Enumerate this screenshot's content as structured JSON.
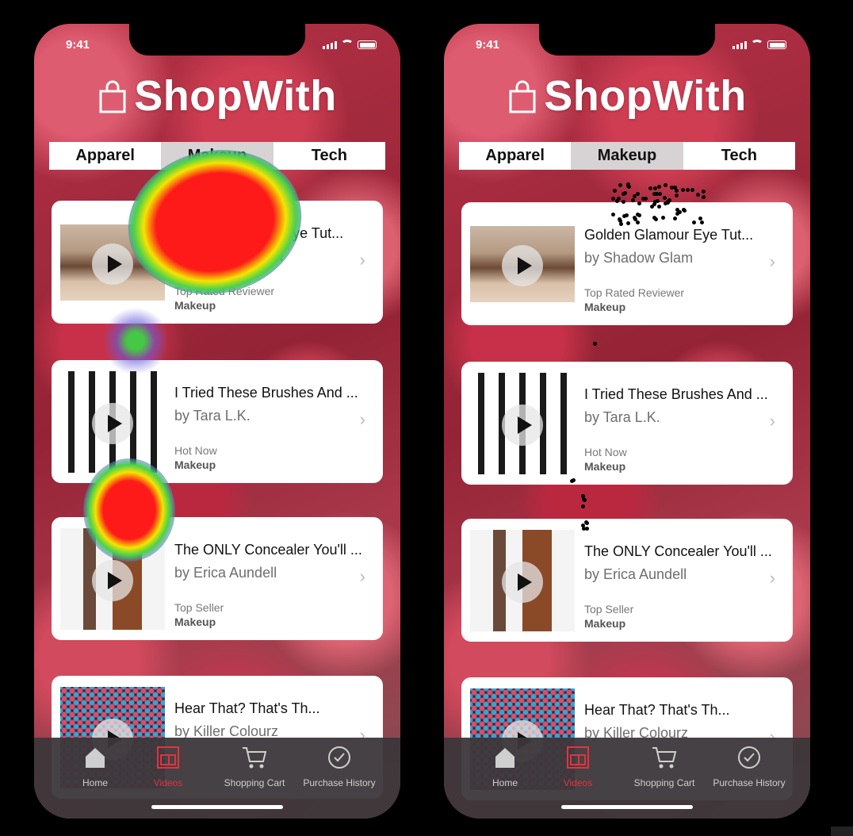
{
  "status": {
    "time": "9:41"
  },
  "app": {
    "title": "ShopWith"
  },
  "tabs": [
    {
      "label": "Apparel"
    },
    {
      "label": "Makeup",
      "active": true
    },
    {
      "label": "Tech"
    }
  ],
  "videos": [
    {
      "title": "Golden Glamour Eye Tut...",
      "author": "by Shadow Glam",
      "badge": "Top Rated Reviewer",
      "category": "Makeup",
      "thumb": "eye-makeup-thumbnail"
    },
    {
      "title": "I Tried These Brushes And ...",
      "author": "by Tara L.K.",
      "badge": "Hot Now",
      "category": "Makeup",
      "thumb": "brushes-thumbnail"
    },
    {
      "title": "The ONLY Concealer You'll ...",
      "author": "by Erica Aundell",
      "badge": "Top Seller",
      "category": "Makeup",
      "thumb": "concealer-thumbnail"
    },
    {
      "title": "Hear That? That's Th...",
      "author": "by Killer Colourz",
      "badge": "",
      "category": "",
      "thumb": "palette-thumbnail"
    }
  ],
  "tabbar": [
    {
      "label": "Home",
      "icon": "home-icon"
    },
    {
      "label": "Videos",
      "icon": "videos-icon",
      "active": true
    },
    {
      "label": "Shopping Cart",
      "icon": "cart-icon"
    },
    {
      "label": "Purchase History",
      "icon": "clock-icon"
    }
  ],
  "colors": {
    "accent": "#e0343f",
    "tab_active": "#d7d3d4",
    "tabbar_bg": "#3c373a"
  }
}
